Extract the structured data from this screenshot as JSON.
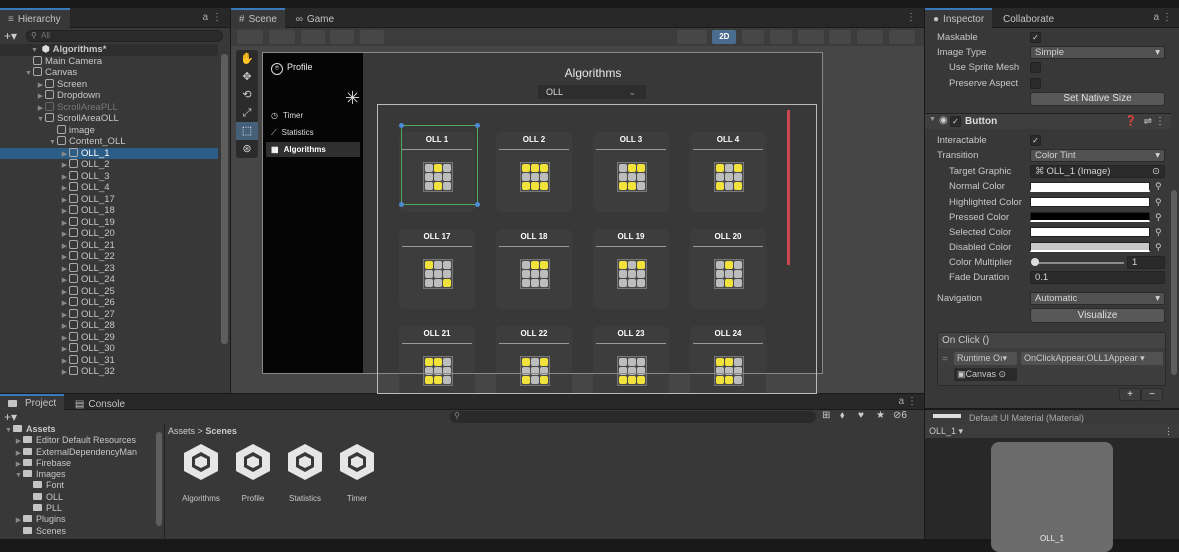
{
  "hierarchy": {
    "tab": "Hierarchy",
    "search_placeholder": "All",
    "scene": "Algorithms*",
    "items": [
      {
        "label": "Main Camera",
        "indent": 2,
        "arrow": "",
        "dim": false,
        "sel": false
      },
      {
        "label": "Canvas",
        "indent": 2,
        "arrow": "▼",
        "dim": false,
        "sel": false
      },
      {
        "label": "Screen",
        "indent": 3,
        "arrow": "▶",
        "dim": false,
        "sel": false
      },
      {
        "label": "Dropdown",
        "indent": 3,
        "arrow": "▶",
        "dim": false,
        "sel": false
      },
      {
        "label": "ScrollAreaPLL",
        "indent": 3,
        "arrow": "▶",
        "dim": true,
        "sel": false
      },
      {
        "label": "ScrollAreaOLL",
        "indent": 3,
        "arrow": "▼",
        "dim": false,
        "sel": false
      },
      {
        "label": "image",
        "indent": 4,
        "arrow": "",
        "dim": false,
        "sel": false
      },
      {
        "label": "Content_OLL",
        "indent": 4,
        "arrow": "▼",
        "dim": false,
        "sel": false
      },
      {
        "label": "OLL_1",
        "indent": 5,
        "arrow": "▶",
        "dim": false,
        "sel": true
      },
      {
        "label": "OLL_2",
        "indent": 5,
        "arrow": "▶",
        "dim": false,
        "sel": false
      },
      {
        "label": "OLL_3",
        "indent": 5,
        "arrow": "▶",
        "dim": false,
        "sel": false
      },
      {
        "label": "OLL_4",
        "indent": 5,
        "arrow": "▶",
        "dim": false,
        "sel": false
      },
      {
        "label": "OLL_17",
        "indent": 5,
        "arrow": "▶",
        "dim": false,
        "sel": false
      },
      {
        "label": "OLL_18",
        "indent": 5,
        "arrow": "▶",
        "dim": false,
        "sel": false
      },
      {
        "label": "OLL_19",
        "indent": 5,
        "arrow": "▶",
        "dim": false,
        "sel": false
      },
      {
        "label": "OLL_20",
        "indent": 5,
        "arrow": "▶",
        "dim": false,
        "sel": false
      },
      {
        "label": "OLL_21",
        "indent": 5,
        "arrow": "▶",
        "dim": false,
        "sel": false
      },
      {
        "label": "OLL_22",
        "indent": 5,
        "arrow": "▶",
        "dim": false,
        "sel": false
      },
      {
        "label": "OLL_23",
        "indent": 5,
        "arrow": "▶",
        "dim": false,
        "sel": false
      },
      {
        "label": "OLL_24",
        "indent": 5,
        "arrow": "▶",
        "dim": false,
        "sel": false
      },
      {
        "label": "OLL_25",
        "indent": 5,
        "arrow": "▶",
        "dim": false,
        "sel": false
      },
      {
        "label": "OLL_26",
        "indent": 5,
        "arrow": "▶",
        "dim": false,
        "sel": false
      },
      {
        "label": "OLL_27",
        "indent": 5,
        "arrow": "▶",
        "dim": false,
        "sel": false
      },
      {
        "label": "OLL_28",
        "indent": 5,
        "arrow": "▶",
        "dim": false,
        "sel": false
      },
      {
        "label": "OLL_29",
        "indent": 5,
        "arrow": "▶",
        "dim": false,
        "sel": false
      },
      {
        "label": "OLL_30",
        "indent": 5,
        "arrow": "▶",
        "dim": false,
        "sel": false
      },
      {
        "label": "OLL_31",
        "indent": 5,
        "arrow": "▶",
        "dim": false,
        "sel": false
      },
      {
        "label": "OLL_32",
        "indent": 5,
        "arrow": "▶",
        "dim": false,
        "sel": false
      }
    ]
  },
  "scene": {
    "tab_scene": "Scene",
    "tab_game": "Game",
    "mode_2d": "2D",
    "menu": {
      "profile": "Profile",
      "timer": "Timer",
      "statistics": "Statistics",
      "algorithms": "Algorithms"
    },
    "title": "Algorithms",
    "dropdown": "OLL",
    "tiles": [
      "OLL 1",
      "OLL 2",
      "OLL 3",
      "OLL 4",
      "OLL 17",
      "OLL 18",
      "OLL 19",
      "OLL 20",
      "OLL 21",
      "OLL 22",
      "OLL 23",
      "OLL 24"
    ]
  },
  "inspector": {
    "tab": "Inspector",
    "tab2": "Collaborate",
    "maskable": "Maskable",
    "image_type_label": "Image Type",
    "image_type_value": "Simple",
    "use_sprite_mesh": "Use Sprite Mesh",
    "preserve_aspect": "Preserve Aspect",
    "set_native_size": "Set Native Size",
    "component": "Button",
    "interactable": "Interactable",
    "transition_label": "Transition",
    "transition_value": "Color Tint",
    "target_graphic_label": "Target Graphic",
    "target_graphic_value": "OLL_1 (Image)",
    "normal_color": "Normal Color",
    "highlighted_color": "Highlighted Color",
    "pressed_color": "Pressed Color",
    "selected_color": "Selected Color",
    "disabled_color": "Disabled Color",
    "color_multiplier": "Color Multiplier",
    "color_multiplier_value": "1",
    "fade_duration": "Fade Duration",
    "fade_duration_value": "0.1",
    "navigation_label": "Navigation",
    "navigation_value": "Automatic",
    "visualize": "Visualize",
    "onclick": "On Click ()",
    "runtime": "Runtime Oı",
    "function": "OnClickAppear.OLL1Appear",
    "object": "Canvas",
    "plus": "+",
    "minus": "−",
    "material": "Default UI Material (Material)",
    "preview_label": "OLL_1",
    "preview_caption": "OLL_1"
  },
  "project": {
    "tab_project": "Project",
    "tab_console": "Console",
    "breadcrumb_root": "Assets",
    "breadcrumb_sep": ">",
    "breadcrumb_leaf": "Scenes",
    "hidden_count": "6",
    "tree": [
      {
        "label": "Assets",
        "indent": 0,
        "arrow": "▼"
      },
      {
        "label": "Editor Default Resources",
        "indent": 1,
        "arrow": "▶"
      },
      {
        "label": "ExternalDependencyMan",
        "indent": 1,
        "arrow": "▶"
      },
      {
        "label": "Firebase",
        "indent": 1,
        "arrow": "▶"
      },
      {
        "label": "Images",
        "indent": 1,
        "arrow": "▼"
      },
      {
        "label": "Font",
        "indent": 2,
        "arrow": ""
      },
      {
        "label": "OLL",
        "indent": 2,
        "arrow": ""
      },
      {
        "label": "PLL",
        "indent": 2,
        "arrow": ""
      },
      {
        "label": "Plugins",
        "indent": 1,
        "arrow": "▶"
      },
      {
        "label": "Scenes",
        "indent": 1,
        "arrow": ""
      }
    ],
    "assets": [
      "Algorithms",
      "Profile",
      "Statistics",
      "Timer"
    ]
  }
}
